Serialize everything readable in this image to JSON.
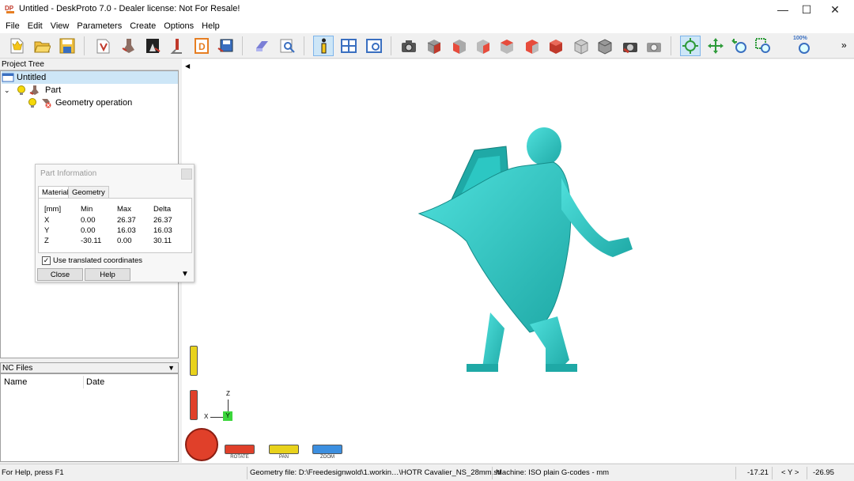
{
  "window": {
    "title": "Untitled - DeskProto 7.0 - Dealer license: Not For Resale!",
    "app_icon_text": "DP",
    "minimize": "—",
    "maximize": "☐",
    "close": "✕"
  },
  "menu": [
    "File",
    "Edit",
    "View",
    "Parameters",
    "Create",
    "Options",
    "Help"
  ],
  "toolbar": {
    "zoom_label": "100%",
    "overflow": "»"
  },
  "project_tree": {
    "header": "Project Tree",
    "items": [
      {
        "label": "Untitled"
      },
      {
        "label": "Part"
      },
      {
        "label": "Geometry operation"
      }
    ]
  },
  "nc_files": {
    "header": "NC Files",
    "columns": [
      "Name",
      "Date"
    ]
  },
  "part_info": {
    "title": "Part Information",
    "tabs": [
      "Material",
      "Geometry"
    ],
    "columns": [
      "[mm]",
      "Min",
      "Max",
      "Delta"
    ],
    "rows": [
      {
        "axis": "X",
        "min": "0.00",
        "max": "26.37",
        "delta": "26.37"
      },
      {
        "axis": "Y",
        "min": "0.00",
        "max": "16.03",
        "delta": "16.03"
      },
      {
        "axis": "Z",
        "min": "-30.11",
        "max": "0.00",
        "delta": "30.11"
      }
    ],
    "checkbox_label": "Use translated coordinates",
    "checkbox_checked": true,
    "close_label": "Close",
    "help_label": "Help"
  },
  "view_controls": {
    "rotate_label": "ROTATE",
    "pan_label": "PAN",
    "zoom_label": "ZOOM",
    "axis_z": "Z",
    "axis_x": "X",
    "axis_y": "Y"
  },
  "status": {
    "help": "For Help, press F1",
    "geometry_file": "Geometry file: D:\\Freedesignwold\\1.workin…\\HOTR Cavalier_NS_28mm.stl",
    "machine": "Machine: ISO plain G-codes - mm",
    "coord_x": "-17.21",
    "coord_mid": "< Y >",
    "coord_y": "-26.95"
  },
  "colors": {
    "model": "#2ec4c0",
    "selection": "#cde6f7",
    "rotate": "#e0402a",
    "pan": "#e8d21c",
    "zoom": "#3c8fe0"
  }
}
